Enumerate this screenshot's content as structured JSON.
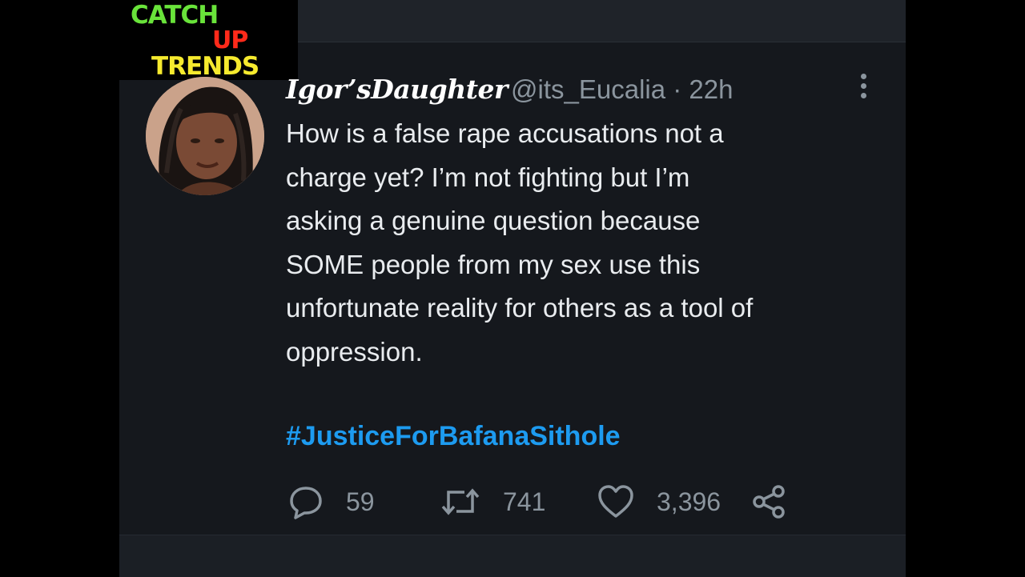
{
  "logo": {
    "line1": "CATCH",
    "line2": "UP",
    "line3": "TRENDS"
  },
  "tweet": {
    "display_name": "Igor’sDaughter",
    "handle_time": "@its_Eucalia · 22h",
    "text": "How is a false rape accusations not a\ncharge yet? I’m not fighting but I’m\nasking a genuine question because\nSOME people from my sex use this\nunfortunate reality for others as a tool of\noppression.",
    "hashtag": "#JusticeForBafanaSithole"
  },
  "actions": {
    "reply_count": "59",
    "retweet_count": "741",
    "like_count": "3,396"
  },
  "icons": [
    "more-icon",
    "reply-icon",
    "retweet-icon",
    "like-icon",
    "share-icon"
  ],
  "colors": {
    "background": "#15181d",
    "text": "#e9ecef",
    "muted": "#8b959e",
    "link": "#1d9bf0"
  }
}
